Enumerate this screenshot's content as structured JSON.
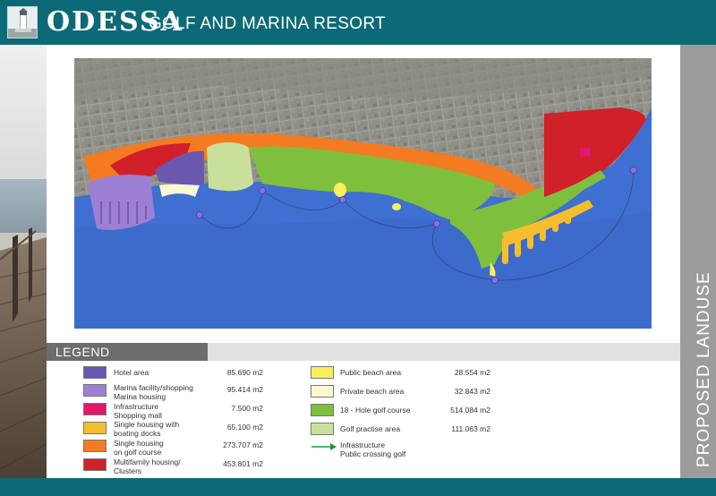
{
  "header": {
    "brand": "ODESSA",
    "subtitle": "GOLF AND MARINA RESORT"
  },
  "side_label": "PROPOSED LANDUSE",
  "legend_title": "LEGEND",
  "legend_left": [
    {
      "label": "Hotel area",
      "value": "85.690 m2",
      "color": "#6a57b0"
    },
    {
      "label": "Marina facility/shopping\nMarina housing",
      "value": "95.414 m2",
      "color": "#9d7fd4"
    },
    {
      "label": "Infrastructure\nShopping mall",
      "value": "7.500 m2",
      "color": "#e0186a"
    },
    {
      "label": "Single housing with\nboating docks",
      "value": "65.100 m2",
      "color": "#f6bd2d"
    },
    {
      "label": "Single housing\non golf course",
      "value": "273.707 m2",
      "color": "#f47b21"
    },
    {
      "label": "Multifamily housing/\nClusters",
      "value": "453.801 m2",
      "color": "#d0202a"
    }
  ],
  "legend_right": [
    {
      "label": "Public beach area",
      "value": "28.554 m2",
      "color": "#f7ef5c"
    },
    {
      "label": "Private beach area",
      "value": "32.843 m2",
      "color": "#fdf7cf"
    },
    {
      "label": "18 - Hole golf course",
      "value": "514.084 m2",
      "color": "#7fbf3e"
    },
    {
      "label": "Golf practise area",
      "value": "111.063 m2",
      "color": "#c9e09a"
    }
  ],
  "legend_line": {
    "label": "Infrastructure\nPublic crossing golf",
    "color": "#1e9a3c"
  },
  "colors": {
    "header": "#0c6a76",
    "sea": "#3f6fd0",
    "land": "#8c8c86",
    "sidebar": "#9c9c9c"
  }
}
